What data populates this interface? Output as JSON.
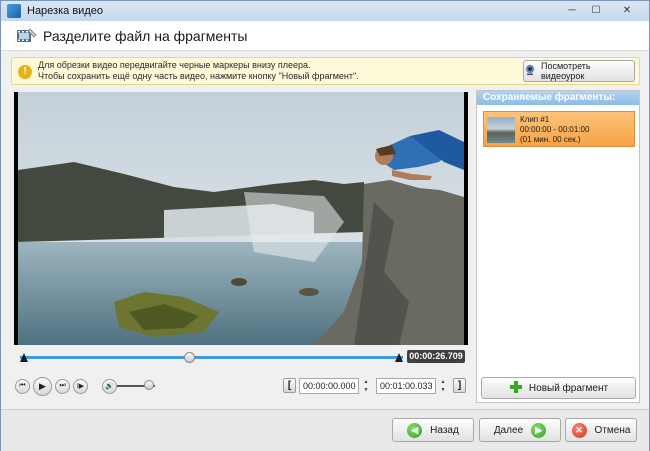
{
  "window": {
    "title": "Нарезка видео",
    "controls": {
      "minimize": "─",
      "maximize": "☐",
      "close": "✕"
    }
  },
  "header": {
    "title": "Разделите файл на фрагменты"
  },
  "info": {
    "line1": "Для обрезки видео передвигайте черные маркеры внизу плеера.",
    "line2": "Чтобы сохранить ещё одну часть видео, нажмите кнопку \"Новый фрагмент\".",
    "lesson_button": "Посмотреть видеоурок"
  },
  "player": {
    "current_time": "00:00:26.709",
    "start_time": "00:00:00.000",
    "end_time": "00:01:00.033",
    "playhead_fraction": 0.44,
    "volume_fraction": 0.85,
    "marker_start_label": "[",
    "marker_end_label": "]",
    "buttons": {
      "prev": "⏮",
      "play": "▶",
      "next": "⏭",
      "step": "I▶",
      "volume": "🔊"
    }
  },
  "fragments": {
    "header": "Сохраняемые фрагменты:",
    "items": [
      {
        "title": "Клип #1",
        "range": "00:00:00 - 00:01:00",
        "duration": "(01 мин. 00 сек.)"
      }
    ],
    "new_button": "Новый фрагмент"
  },
  "footer": {
    "back_button": "Назад",
    "next_button": "Далее",
    "cancel_button": "Отмена"
  },
  "icons": {
    "app": "film-cut-icon",
    "header": "film-strip-icon",
    "info": "info-icon",
    "lesson": "webcam-icon",
    "add": "plus-icon",
    "back": "arrow-left-icon",
    "next": "arrow-right-icon",
    "cancel": "cross-icon"
  },
  "colors": {
    "accent": "#3f9be0",
    "selected_clip": "#f6a346",
    "info_bg": "#fdf9d9",
    "panel_header": "#8cbbe5"
  }
}
